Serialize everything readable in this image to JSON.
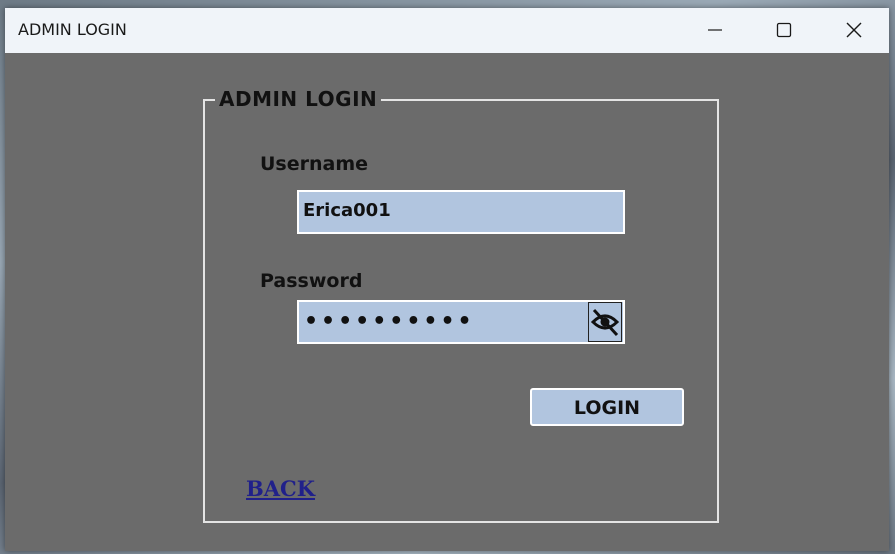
{
  "window": {
    "title": "ADMIN LOGIN"
  },
  "form": {
    "group_title": "ADMIN LOGIN",
    "username_label": "Username",
    "username_value": "Erica001",
    "password_label": "Password",
    "password_masked": "••••••••••",
    "toggle_icon": "eye-slash-icon",
    "login_label": "LOGIN",
    "back_label": "BACK"
  },
  "colors": {
    "content_bg": "#6b6b6b",
    "field_bg": "#b1c5df",
    "back_link": "#20208a",
    "titlebar_bg": "#f0f4f9"
  }
}
